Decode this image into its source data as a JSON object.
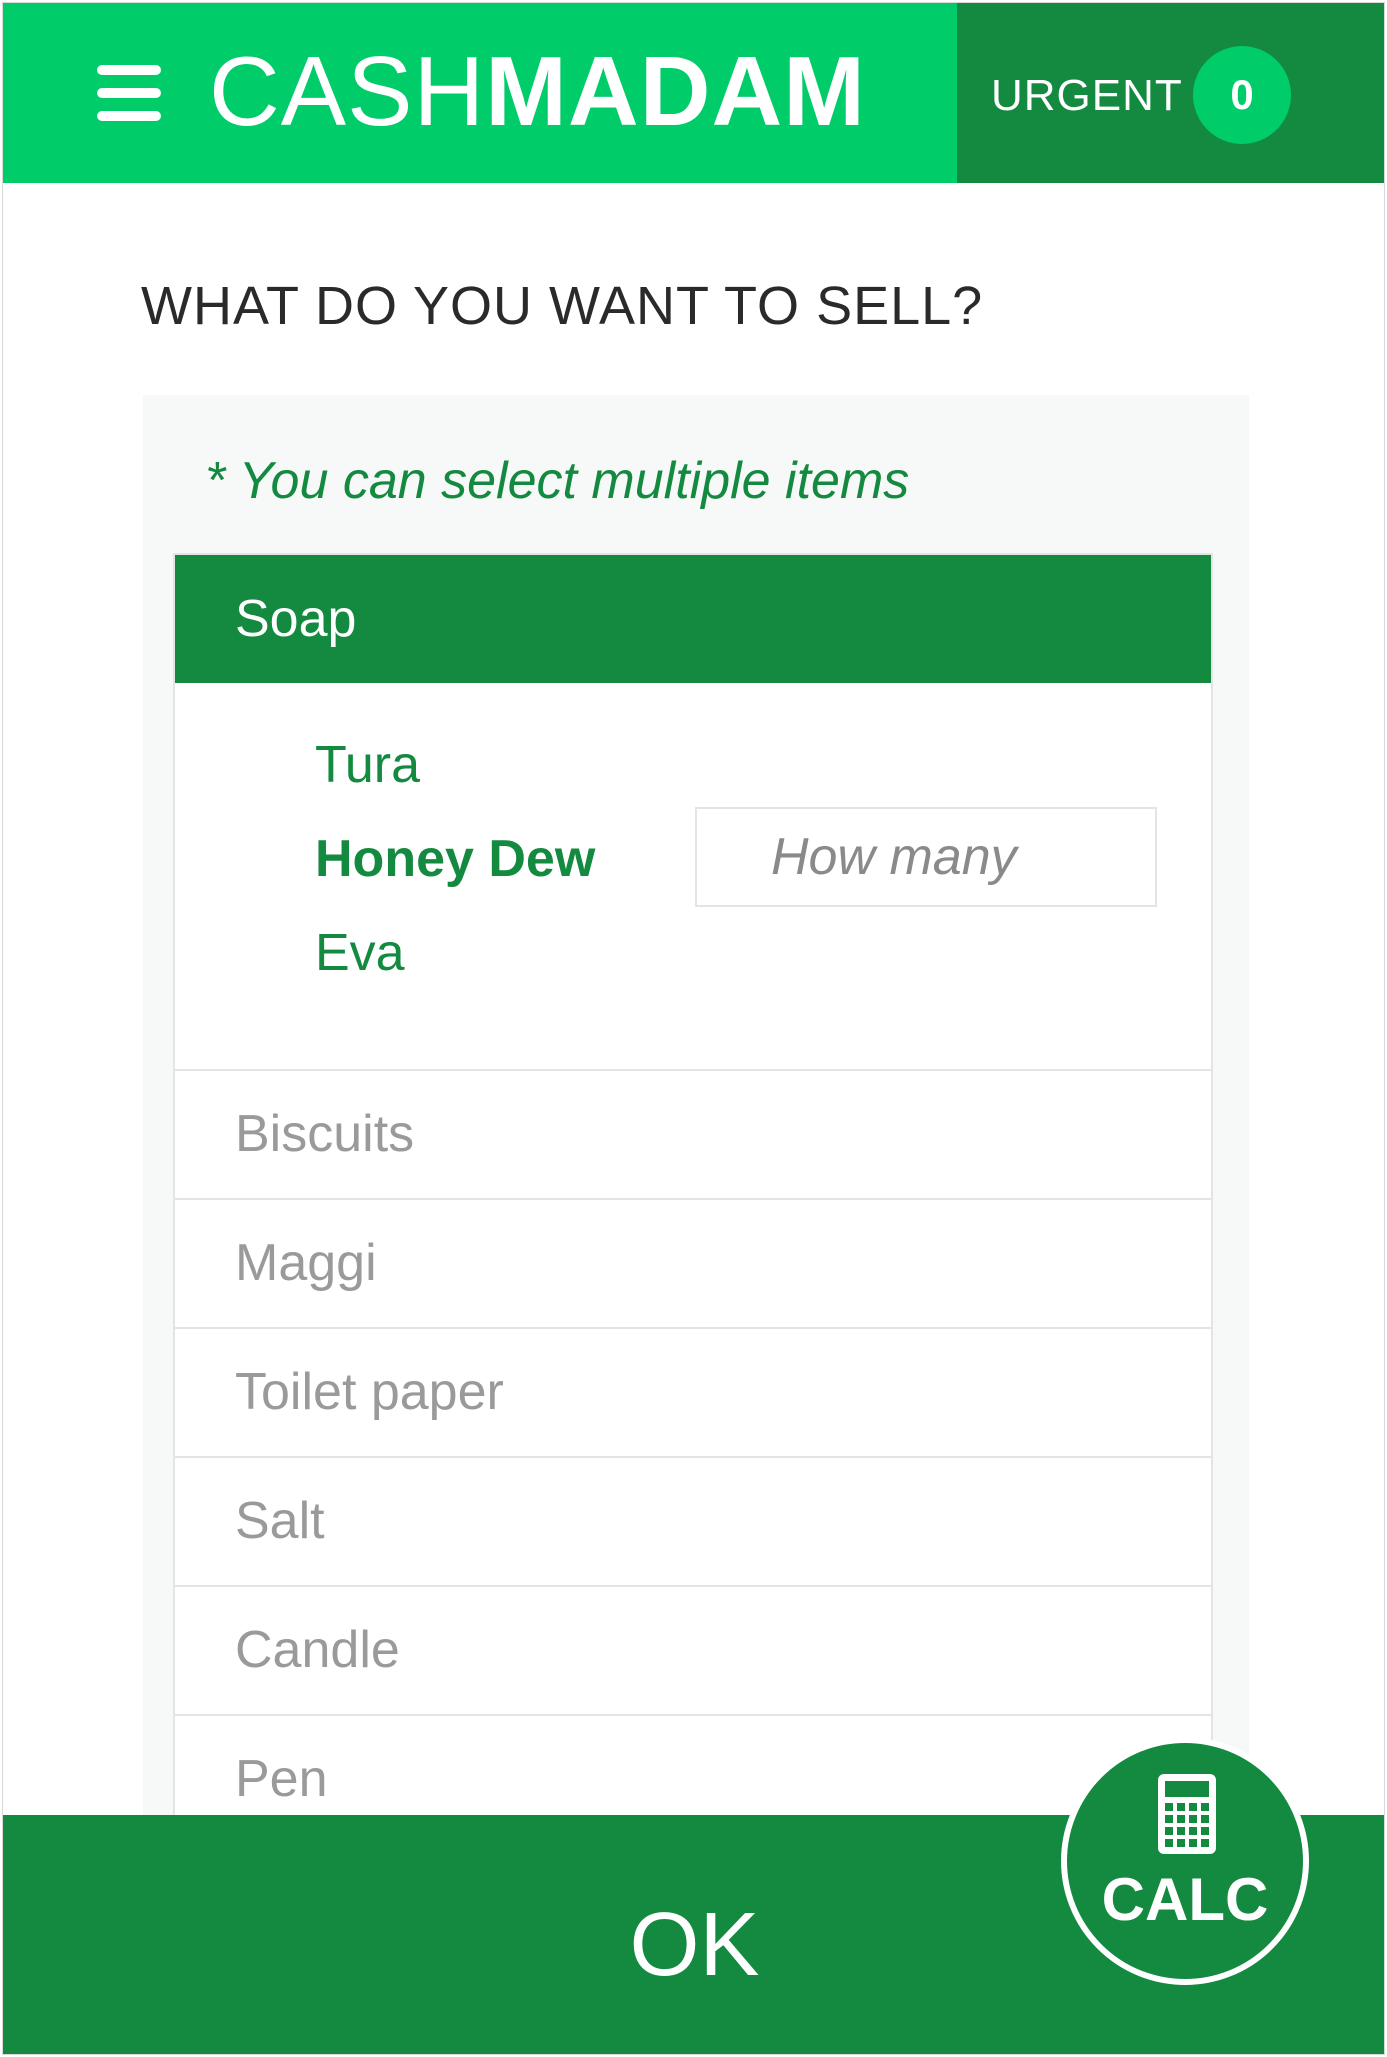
{
  "header": {
    "logo_light": "CASH",
    "logo_bold": "MADAM",
    "urgent_label": "URGENT",
    "urgent_count": "0",
    "menu_icon": "hamburger-menu-icon"
  },
  "main": {
    "question": "WHAT DO YOU WANT TO SELL?",
    "hint": "* You can select multiple items",
    "categories": [
      {
        "label": "Soap",
        "expanded": true
      },
      {
        "label": "Biscuits"
      },
      {
        "label": "Maggi"
      },
      {
        "label": "Toilet paper"
      },
      {
        "label": "Salt"
      },
      {
        "label": "Candle"
      },
      {
        "label": "Pen"
      }
    ],
    "subitems": [
      {
        "label": "Tura"
      },
      {
        "label": "Honey Dew",
        "selected": true
      },
      {
        "label": "Eva"
      }
    ],
    "quantity_placeholder": "How many"
  },
  "footer": {
    "ok_label": "OK",
    "calc_label": "CALC",
    "calc_icon": "calculator-icon"
  },
  "colors": {
    "brand_green": "#00cc6a",
    "dark_green": "#138a3f",
    "muted_text": "#9a9a9a"
  }
}
